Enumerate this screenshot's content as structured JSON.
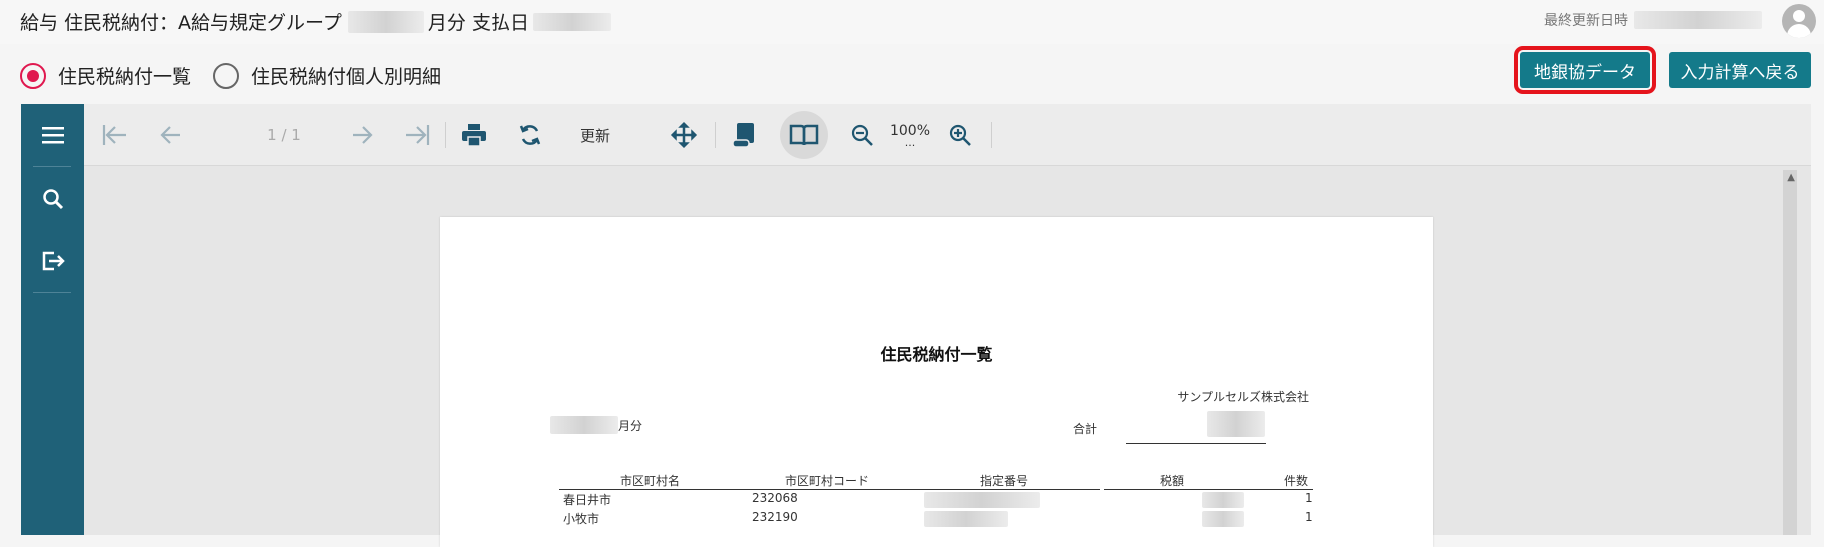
{
  "header": {
    "title_prefix": "給与 住民税納付：A給与規定グループ",
    "title_month_suffix": "月分 支払日",
    "last_updated_label": "最終更新日時"
  },
  "report_options": [
    {
      "label": "住民税納付一覧",
      "checked": true
    },
    {
      "label": "住民税納付個人別明細",
      "checked": false
    }
  ],
  "actions": {
    "chigin_label": "地銀協データ",
    "back_label": "入力計算へ戻る"
  },
  "toolbar": {
    "page_count": "1 / 1",
    "refresh_label": "更新",
    "zoom": "100%",
    "zoom_more": "..."
  },
  "icons": {
    "menu": "menu-icon",
    "search": "search-icon",
    "export": "export-icon",
    "first": "first-page-icon",
    "prev": "prev-page-icon",
    "next": "next-page-icon",
    "last": "last-page-icon",
    "print": "print-icon",
    "refresh": "refresh-icon",
    "pan": "move-icon",
    "scroll_mode": "scroll-icon",
    "book_mode": "book-icon",
    "zoom_out": "zoom-out-icon",
    "zoom_in": "zoom-in-icon"
  },
  "colors": {
    "accent": "#147a8a",
    "sidebar": "#1f6178",
    "radio_checked": "#e0184f",
    "highlight_border": "#e5141c"
  },
  "document": {
    "title": "住民税納付一覧",
    "company": "サンプルセルズ株式会社",
    "month_suffix": "月分",
    "total_label": "合計",
    "columns": [
      "市区町村名",
      "市区町村コード",
      "指定番号",
      "税額",
      "件数"
    ],
    "rows": [
      {
        "city": "春日井市",
        "code": "232068",
        "count": "1"
      },
      {
        "city": "小牧市",
        "code": "232190",
        "count": "1"
      }
    ]
  }
}
